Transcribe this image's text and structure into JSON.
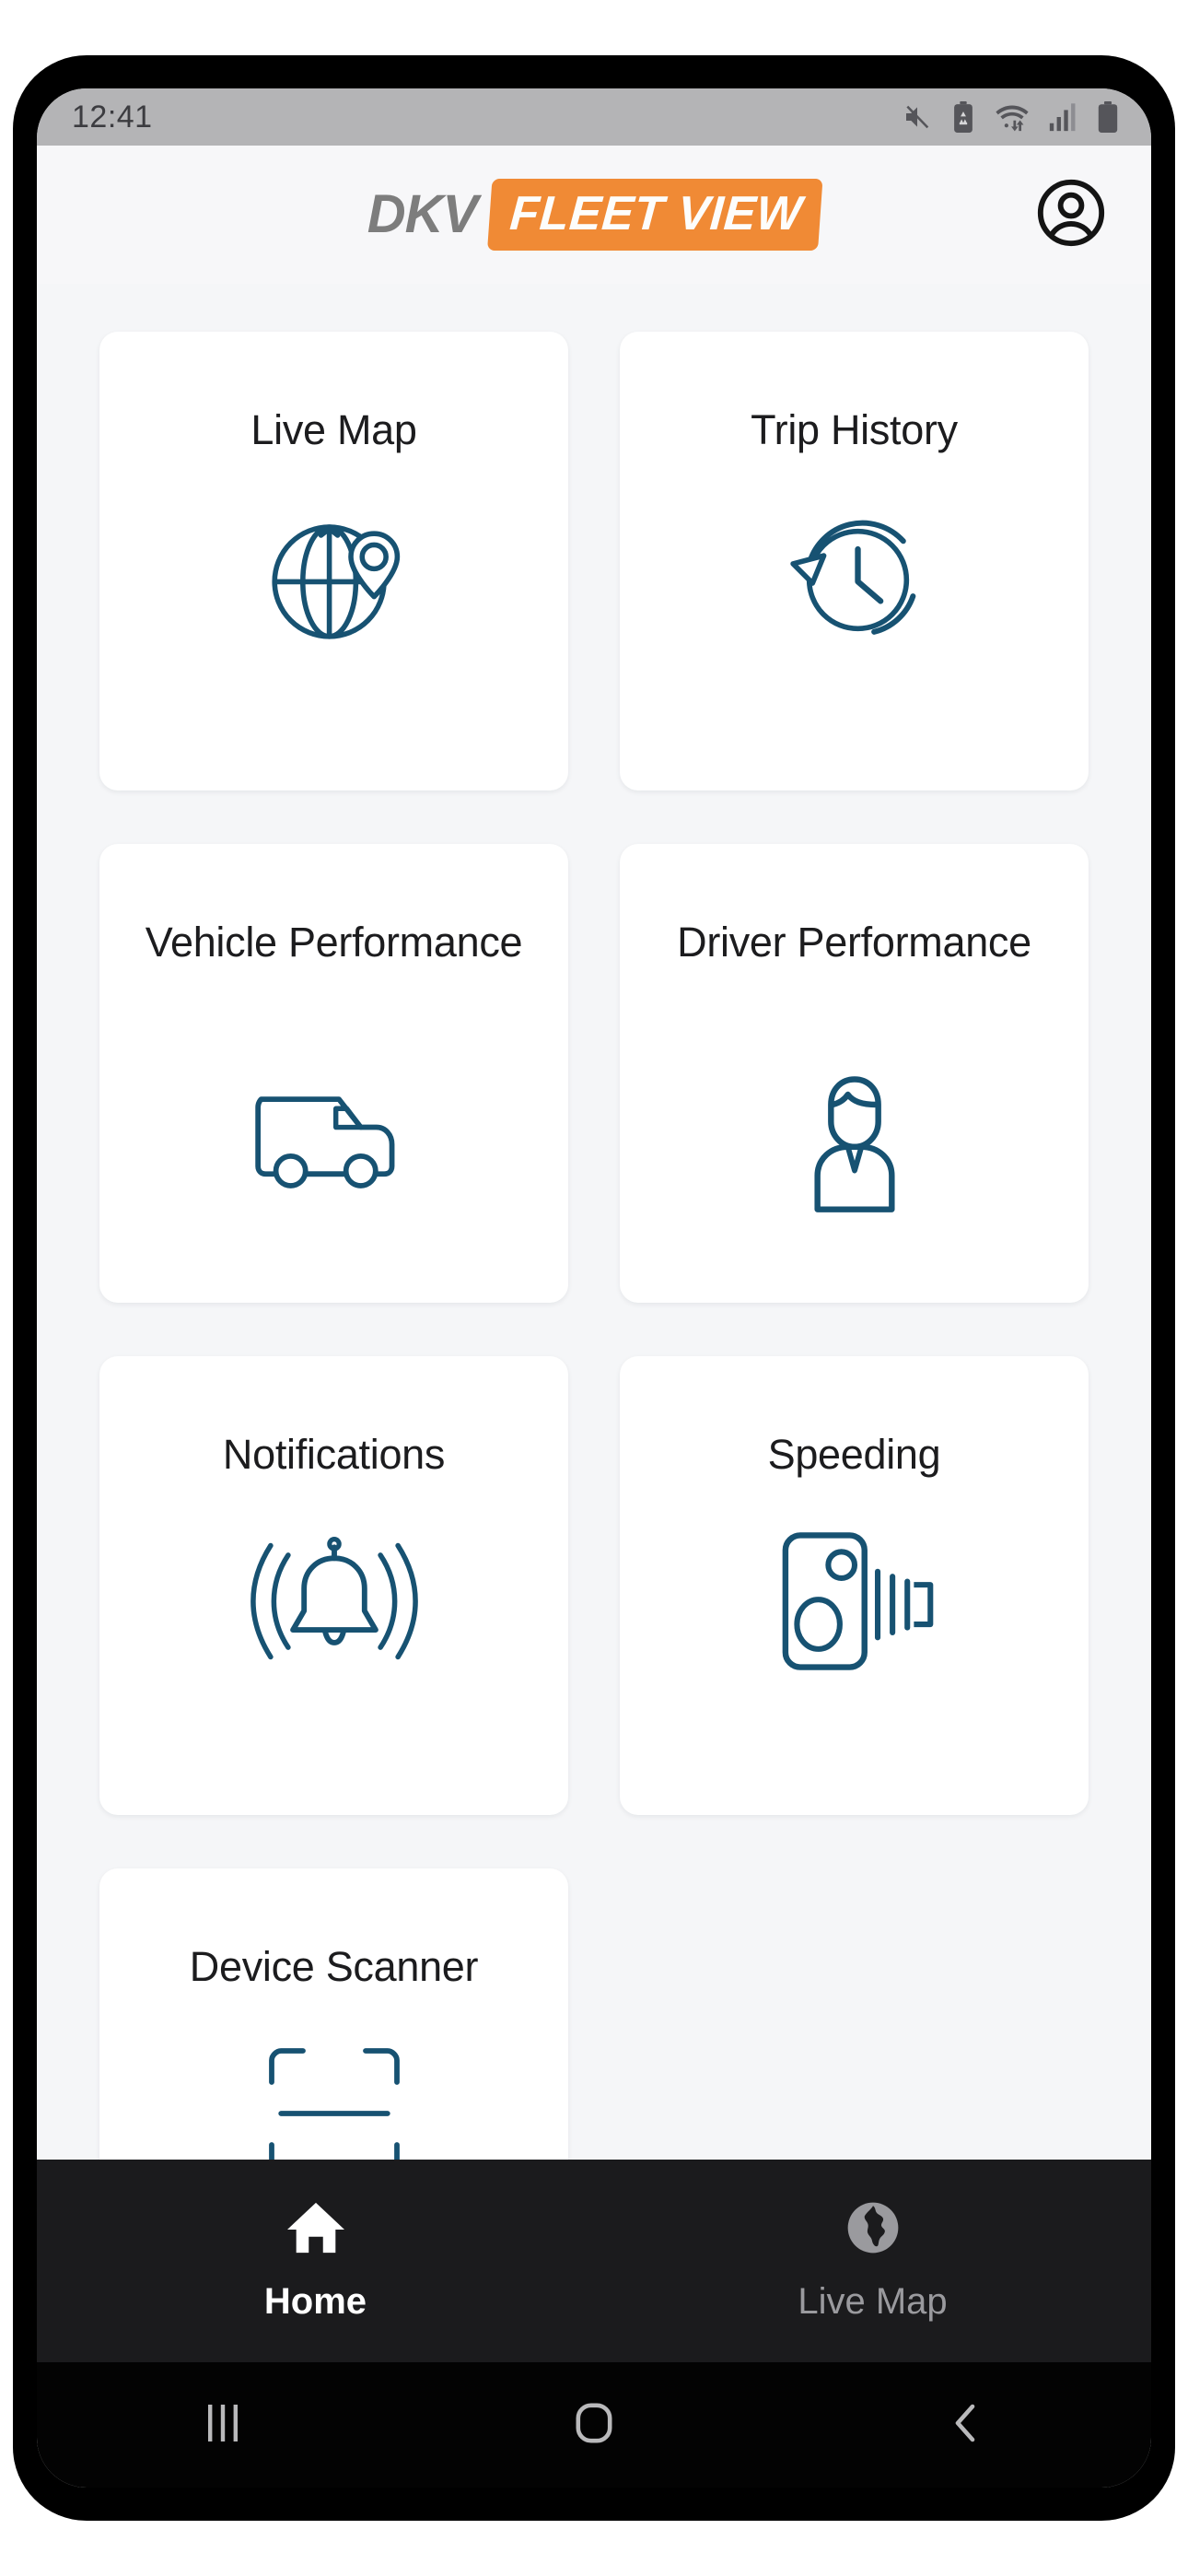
{
  "status_bar": {
    "time": "12:41",
    "icons": [
      "mute-icon",
      "battery-saver-icon",
      "wifi-icon",
      "cellular-signal-icon",
      "battery-icon"
    ]
  },
  "header": {
    "brand_primary": "DKV",
    "brand_secondary": "FLEET VIEW",
    "brand_accent_color": "#f08a35",
    "brand_primary_color": "#7d7d7d",
    "account_icon": "account-circle-icon"
  },
  "home": {
    "tiles": [
      {
        "label": "Live Map",
        "icon": "globe-pin-icon",
        "lines": 1
      },
      {
        "label": "Trip History",
        "icon": "clock-history-icon",
        "lines": 1
      },
      {
        "label": "Vehicle Performance",
        "icon": "van-icon",
        "lines": 2
      },
      {
        "label": "Driver Performance",
        "icon": "driver-icon",
        "lines": 2
      },
      {
        "label": "Notifications",
        "icon": "bell-ring-icon",
        "lines": 1
      },
      {
        "label": "Speeding",
        "icon": "speed-camera-icon",
        "lines": 1
      },
      {
        "label": "Device Scanner",
        "icon": "scanner-icon",
        "lines": 1
      }
    ],
    "icon_color": "#175272",
    "card_background": "#ffffff",
    "page_background": "#f5f6f8"
  },
  "bottom_nav": {
    "items": [
      {
        "label": "Home",
        "icon": "home-icon",
        "active": true
      },
      {
        "label": "Live Map",
        "icon": "globe-icon",
        "active": false
      }
    ],
    "background": "#1b1b1d",
    "active_color": "#ffffff",
    "inactive_color": "#9a9a9e"
  },
  "system_nav": {
    "buttons": [
      "recents-icon",
      "home-square-icon",
      "back-icon"
    ],
    "color": "#b9b9bb"
  }
}
